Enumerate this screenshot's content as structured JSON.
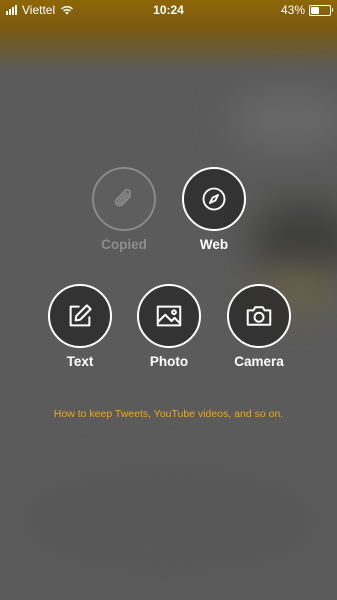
{
  "status_bar": {
    "carrier": "Viettel",
    "time": "10:24",
    "battery_percent": "43%",
    "battery_level": 0.43
  },
  "actions": {
    "copied": {
      "label": "Copied",
      "icon": "paperclip-icon",
      "enabled": false
    },
    "web": {
      "label": "Web",
      "icon": "compass-icon",
      "enabled": true
    },
    "text": {
      "label": "Text",
      "icon": "compose-icon",
      "enabled": true
    },
    "photo": {
      "label": "Photo",
      "icon": "image-icon",
      "enabled": true
    },
    "camera": {
      "label": "Camera",
      "icon": "camera-icon",
      "enabled": true
    }
  },
  "help_link": "How to keep Tweets, YouTube videos, and so on.",
  "colors": {
    "accent": "#f0a818",
    "header_tint": "#8f6708"
  }
}
